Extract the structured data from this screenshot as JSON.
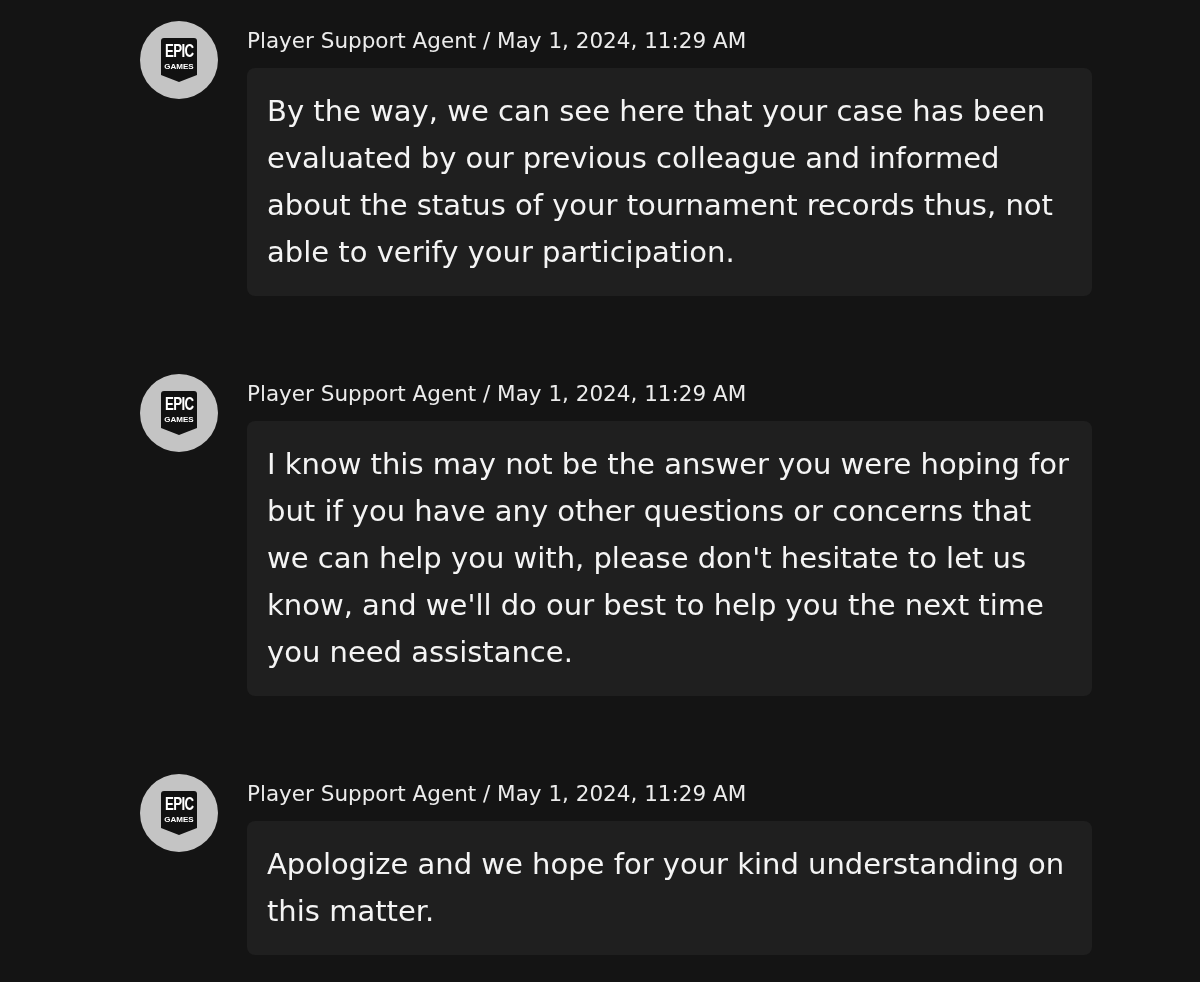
{
  "messages": [
    {
      "avatar": {
        "logo_text": [
          "EPIC",
          "GAMES"
        ]
      },
      "byline": "Player Support Agent / May 1, 2024, 11:29 AM",
      "body": "By the way, we can see here that your case has been evaluated by our previous colleague and informed about the status of your tournament records thus, not able to verify your participation."
    },
    {
      "avatar": {
        "logo_text": [
          "EPIC",
          "GAMES"
        ]
      },
      "byline": "Player Support Agent / May 1, 2024, 11:29 AM",
      "body": "I know this may not be the answer you were hoping for but if you have any other questions or concerns that we can help you with, please don't hesitate to let us know, and we'll do our best to help you the next time you need assistance."
    },
    {
      "avatar": {
        "logo_text": [
          "EPIC",
          "GAMES"
        ]
      },
      "byline": "Player Support Agent / May 1, 2024, 11:29 AM",
      "body": "Apologize and we hope for your kind understanding on this matter."
    }
  ]
}
